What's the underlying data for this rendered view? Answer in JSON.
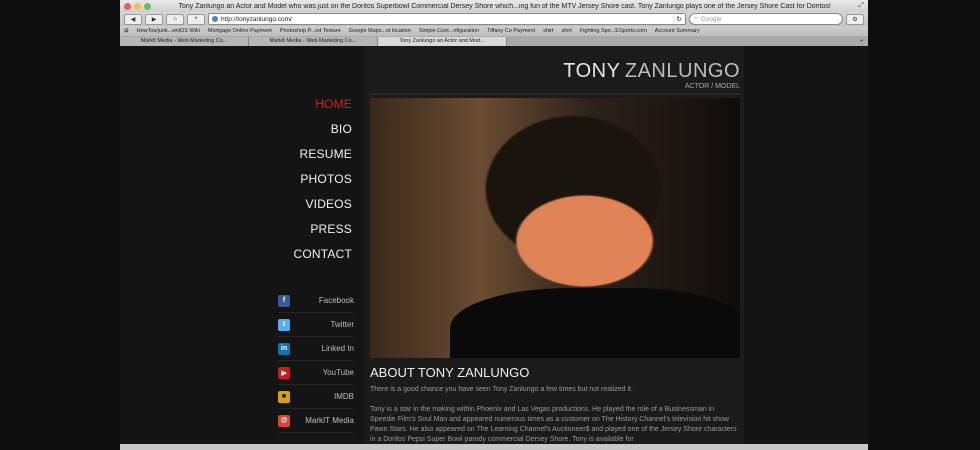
{
  "browser": {
    "window_title": "Tony Zanlungo an Actor and Model who was just on the Doritos Superbowl Commercial Dersey Shore which...ing fun of the MTV Jersey Shore cast. Tony Zanlungo plays one of the Jersey Shore Cast for Doritos!",
    "url": "http://tonyzanlungo.com/",
    "search_placeholder": "Google",
    "bookmarks": [
      "HowTos/junk...entOS Wiki",
      "Mortgage Online Payment",
      "Photoshop P...od Texture",
      "Google Maps...st location",
      "Simple Cont...nfiguration",
      "Tiffany Co Payment",
      "shirt",
      "shirt",
      "Fighting Spo...ESports.com",
      "Account Summary"
    ],
    "tabs": [
      "MarkIt Media - Web Marketing Co...",
      "MarkIt Media - Web Marketing Co...",
      "Tony Zanlungo an Actor and Mod..."
    ]
  },
  "site": {
    "logo_first": "TONY",
    "logo_last": "ZANLUNGO",
    "tagline": "ACTOR / MODEL",
    "nav": [
      "HOME",
      "BIO",
      "RESUME",
      "PHOTOS",
      "VIDEOS",
      "PRESS",
      "CONTACT"
    ],
    "social": [
      {
        "label": "Facebook",
        "icon": "facebook-icon",
        "color": "#3b5998",
        "glyph": "f"
      },
      {
        "label": "Twitter",
        "icon": "twitter-icon",
        "color": "#55acee",
        "glyph": "t"
      },
      {
        "label": "Linked In",
        "icon": "linkedin-icon",
        "color": "#0e76a8",
        "glyph": "in"
      },
      {
        "label": "YouTube",
        "icon": "youtube-icon",
        "color": "#cc181e",
        "glyph": "▶"
      },
      {
        "label": "IMDB",
        "icon": "imdb-icon",
        "color": "#d8a200",
        "glyph": "■"
      },
      {
        "label": "MarkIT Media",
        "icon": "markit-icon",
        "color": "#d9452a",
        "glyph": "@"
      }
    ],
    "about_title": "ABOUT TONY ZANLUNGO",
    "about_p1": "There is a good chance you have seen Tony Zanlungo a few times but not realized it.",
    "about_p2": "Tony is a star in the making within Phoenix and Las Vegas productions. He played the role of a Businessman in Speedie Film's Soul Man and appeared numerous times as a customer on The History Channel's television hit show Pawn Stars. He also appeared on The Learning Channel's Auctioneer$ and played one of the Jersey Shore characters in a Doritos Pepsi Super Bowl parody commercial Dersey Shore. Tony is available for"
  }
}
